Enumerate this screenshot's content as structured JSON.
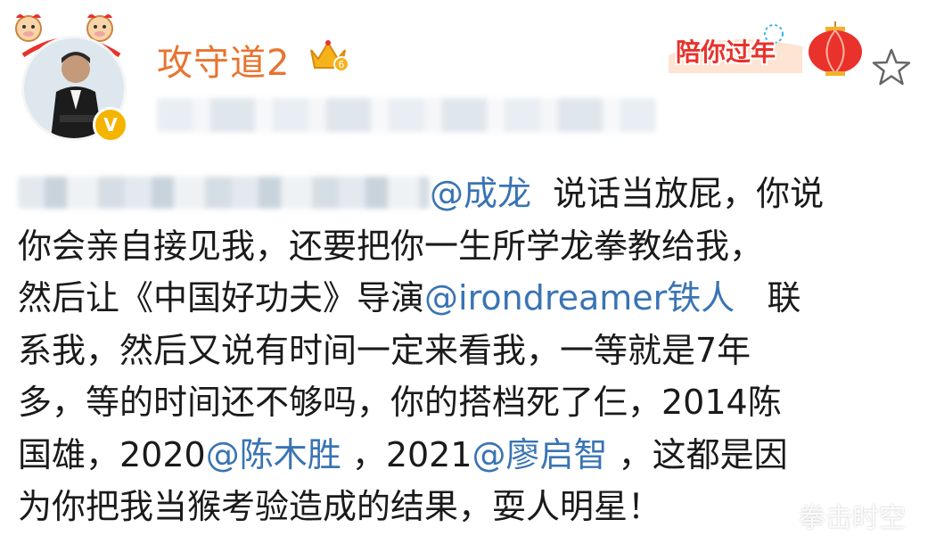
{
  "header": {
    "username": "攻守道2",
    "verified_badge": "V",
    "crown_level": "6",
    "crown_icon": "crown-icon",
    "event_badge": "陪你过年",
    "event_icon": "lantern-icon",
    "favorite_icon": "star-outline-icon"
  },
  "post": {
    "lines": [
      {
        "pre": "",
        "mention": "@成龙",
        "post": "  说话当放屁，你说"
      },
      {
        "text": "你会亲自接见我，还要把你一生所学龙拳教给我，"
      },
      {
        "pre": "然后让《中国好功夫》导演",
        "mention": "@irondreamer铁人",
        "post": "   联"
      },
      {
        "text": "系我，然后又说有时间一定来看我，一等就是7年"
      },
      {
        "text": "多，等的时间还不够吗，你的搭档死了仨，2014陈"
      },
      {
        "pre": "国雄，2020",
        "mention": "@陈木胜",
        "mid": " ，2021",
        "mention2": "@廖启智",
        "post": " ，这都是因"
      },
      {
        "text": "为你把我当猴考验造成的结果，耍人明星！"
      }
    ]
  },
  "watermark": "拳击时空",
  "colors": {
    "username": "#e8742f",
    "mention": "#3a74b3",
    "verified": "#f4b400",
    "event": "#e8322b"
  }
}
